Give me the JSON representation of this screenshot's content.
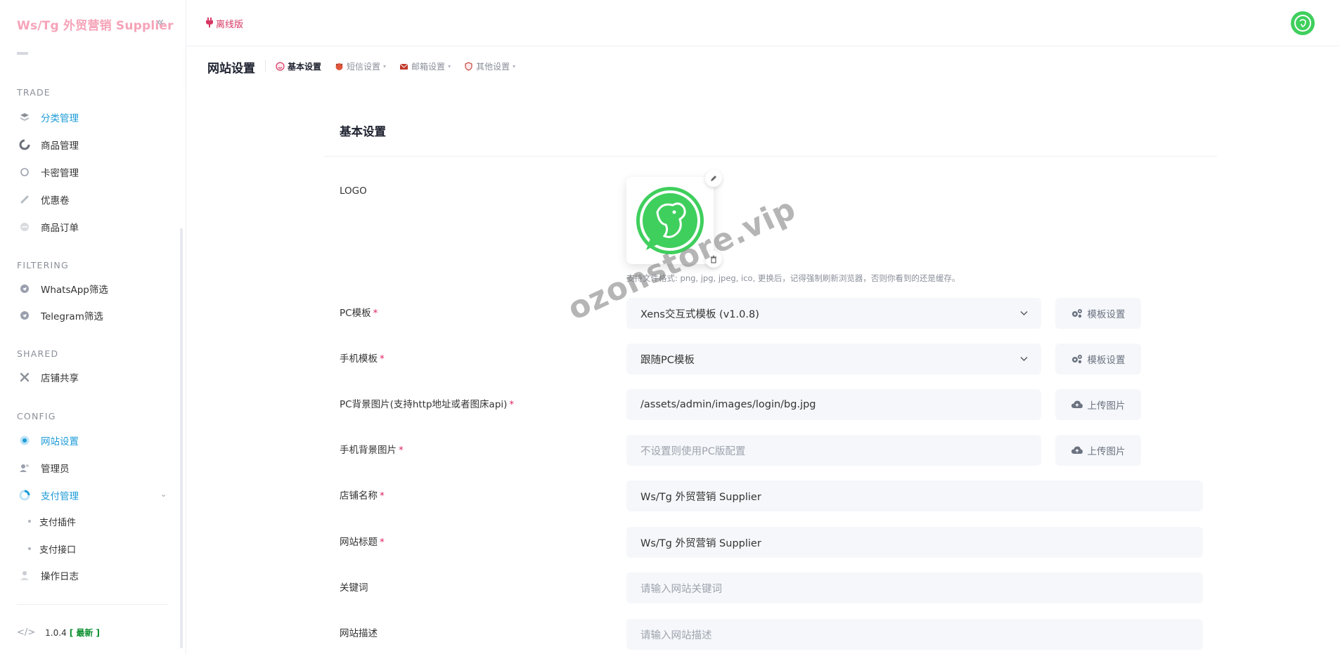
{
  "sidebar": {
    "brand": "Ws/Tg 外贸营销 Supplier",
    "sections": {
      "trade": "TRADE",
      "filtering": "FILTERING",
      "shared": "SHARED",
      "config": "CONFIG"
    },
    "items": {
      "category": "分类管理",
      "goods": "商品管理",
      "card": "卡密管理",
      "coupon": "优惠卷",
      "orders": "商品订单",
      "whatsapp": "WhatsApp筛选",
      "telegram": "Telegram筛选",
      "shop_share": "店铺共享",
      "site_settings": "网站设置",
      "admin": "管理员",
      "payment": "支付管理",
      "payment_plugin": "支付插件",
      "payment_api": "支付接口",
      "op_log": "操作日志"
    },
    "version": "1.0.4",
    "version_tag": "[ 最新 ]"
  },
  "topbar": {
    "offline_label": "离线版"
  },
  "subheader": {
    "title": "网站设置",
    "tabs": [
      "基本设置",
      "短信设置",
      "邮箱设置",
      "其他设置"
    ]
  },
  "form": {
    "card_title": "基本设置",
    "logo_label": "LOGO",
    "logo_hint": "支持文件格式: png, jpg, jpeg, ico, 更换后，记得强制刷新浏览器，否则你看到的还是缓存。",
    "pc_template_label": "PC模板",
    "pc_template_value": "Xens交互式模板 (v1.0.8)",
    "mobile_template_label": "手机模板",
    "mobile_template_value": "跟随PC模板",
    "template_btn": "模板设置",
    "pc_bg_label": "PC背景图片(支持http地址或者图床api)",
    "pc_bg_value": "/assets/admin/images/login/bg.jpg",
    "mobile_bg_label": "手机背景图片",
    "mobile_bg_placeholder": "不设置则使用PC版配置",
    "upload_btn": "上传图片",
    "shop_name_label": "店铺名称",
    "shop_name_value": "Ws/Tg 外贸营销 Supplier",
    "site_title_label": "网站标题",
    "site_title_value": "Ws/Tg 外贸营销 Supplier",
    "keywords_label": "关键词",
    "keywords_placeholder": "请输入网站关键词",
    "desc_label": "网站描述",
    "desc_placeholder": "请输入网站描述"
  },
  "watermark": "ozonstore.vip",
  "colors": {
    "accent": "#1d9bd7",
    "brand": "#f6a3b8",
    "required": "#e0245e",
    "logo_green": "#3fcf5d"
  }
}
